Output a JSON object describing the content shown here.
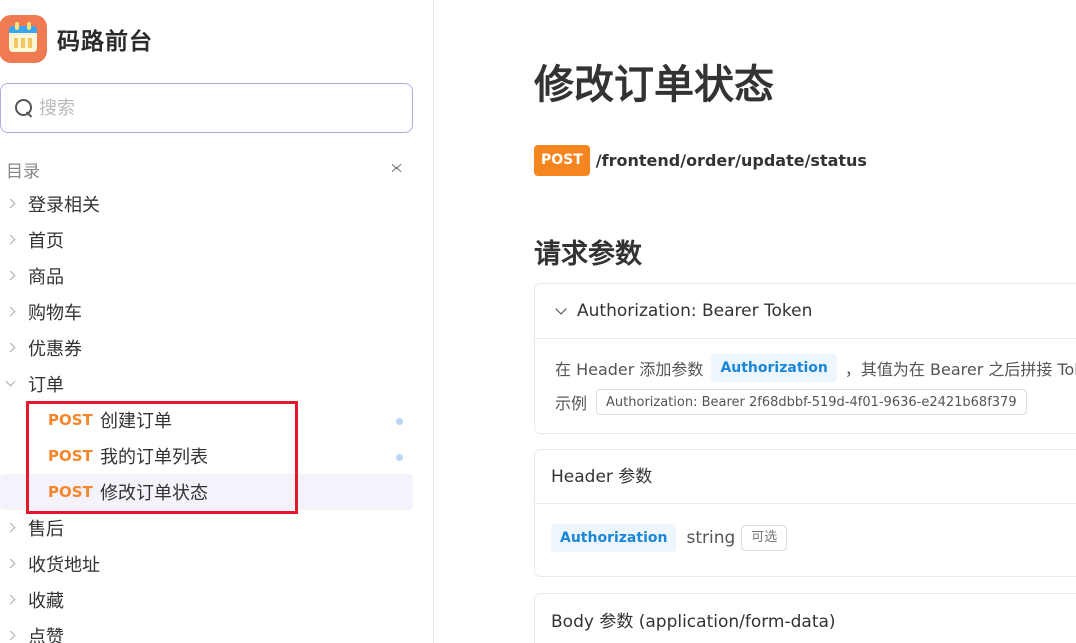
{
  "brand": {
    "name": "码路前台"
  },
  "search": {
    "placeholder": "搜索"
  },
  "toc": {
    "title": "目录"
  },
  "nav": {
    "items": [
      {
        "label": "登录相关"
      },
      {
        "label": "首页"
      },
      {
        "label": "商品"
      },
      {
        "label": "购物车"
      },
      {
        "label": "优惠券"
      },
      {
        "label": "订单"
      }
    ],
    "order_children": [
      {
        "method": "POST",
        "label": "创建订单"
      },
      {
        "method": "POST",
        "label": "我的订单列表"
      },
      {
        "method": "POST",
        "label": "修改订单状态"
      }
    ],
    "items_after": [
      {
        "label": "售后"
      },
      {
        "label": "收货地址"
      },
      {
        "label": "收藏"
      },
      {
        "label": "点赞"
      }
    ]
  },
  "main": {
    "title": "修改订单状态",
    "method": "POST",
    "path": "/frontend/order/update/status",
    "section_title": "请求参数",
    "auth": {
      "header": "Authorization: Bearer Token",
      "desc_prefix": "在 Header 添加参数",
      "param": "Authorization",
      "desc_suffix": "，其值为在 Bearer 之后拼接 Token",
      "example_label": "示例",
      "example_value": "Authorization: Bearer 2f68dbbf-519d-4f01-9636-e2421b68f379"
    },
    "header_params": {
      "title": "Header 参数",
      "name": "Authorization",
      "type": "string",
      "optional": "可选"
    },
    "body_params": {
      "title": "Body 参数 (application/form-data)"
    }
  },
  "colors": {
    "accent_post": "#f5861f",
    "highlight_box": "#e3182c",
    "tag_blue": "#1a86d8"
  }
}
